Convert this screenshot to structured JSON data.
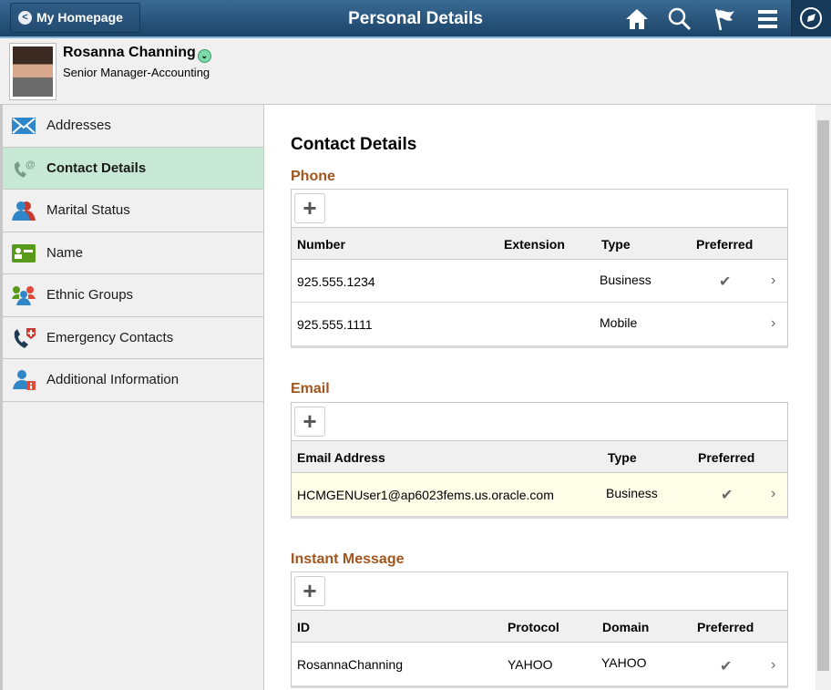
{
  "header": {
    "back_label": "My Homepage",
    "title": "Personal Details",
    "icons": [
      "home-icon",
      "search-icon",
      "flag-icon",
      "menu-icon",
      "navbar-compass-icon"
    ]
  },
  "profile": {
    "name": "Rosanna Channing",
    "job_title": "Senior Manager-Accounting"
  },
  "sidebar": {
    "items": [
      {
        "label": "Addresses",
        "icon": "envelope-icon"
      },
      {
        "label": "Contact Details",
        "icon": "phone-at-icon",
        "selected": true
      },
      {
        "label": "Marital Status",
        "icon": "couple-icon"
      },
      {
        "label": "Name",
        "icon": "id-card-icon"
      },
      {
        "label": "Ethnic Groups",
        "icon": "group-icon"
      },
      {
        "label": "Emergency Contacts",
        "icon": "emergency-phone-icon"
      },
      {
        "label": "Additional Information",
        "icon": "person-info-icon"
      }
    ]
  },
  "main": {
    "title": "Contact Details",
    "phone": {
      "title": "Phone",
      "columns": [
        "Number",
        "Extension",
        "Type",
        "Preferred"
      ],
      "rows": [
        {
          "number": "925.555.1234",
          "extension": "",
          "type": "Business",
          "preferred": true
        },
        {
          "number": "925.555.1111",
          "extension": "",
          "type": "Mobile",
          "preferred": false
        }
      ]
    },
    "email": {
      "title": "Email",
      "columns": [
        "Email Address",
        "Type",
        "Preferred"
      ],
      "rows": [
        {
          "address": "HCMGENUser1@ap6023fems.us.oracle.com",
          "type": "Business",
          "preferred": true
        }
      ]
    },
    "im": {
      "title": "Instant Message",
      "columns": [
        "ID",
        "Protocol",
        "Domain",
        "Preferred"
      ],
      "rows": [
        {
          "id": "RosannaChanning",
          "protocol": "YAHOO",
          "domain": "YAHOO",
          "preferred": true
        }
      ]
    },
    "check_glyph": "✔",
    "chevron_glyph": "›",
    "add_glyph": "+"
  },
  "colors": {
    "header": "#1c4468",
    "selected": "#c8e8d6",
    "section": "#a0561e",
    "highlight_row": "#fdfde8"
  }
}
